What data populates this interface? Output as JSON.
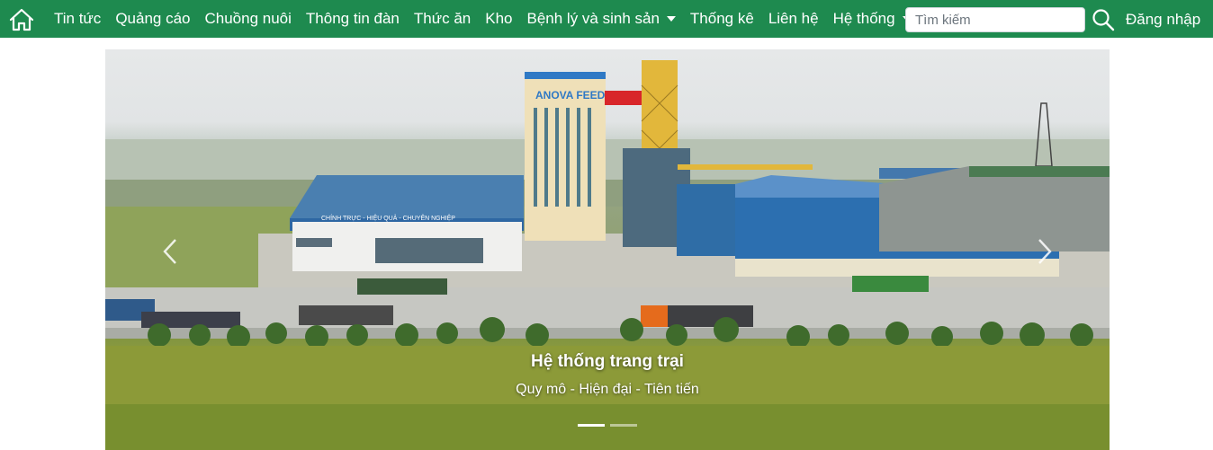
{
  "nav": {
    "menu": [
      {
        "label": "Tin tức",
        "dropdown": false
      },
      {
        "label": "Quảng cáo",
        "dropdown": false
      },
      {
        "label": "Chuồng nuôi",
        "dropdown": false
      },
      {
        "label": "Thông tin đàn",
        "dropdown": false
      },
      {
        "label": "Thức ăn",
        "dropdown": false
      },
      {
        "label": "Kho",
        "dropdown": false
      },
      {
        "label": "Bệnh lý và sinh sản",
        "dropdown": true
      },
      {
        "label": "Thống kê",
        "dropdown": false
      },
      {
        "label": "Liên hệ",
        "dropdown": false
      },
      {
        "label": "Hệ thống",
        "dropdown": true
      }
    ],
    "search_placeholder": "Tìm kiếm",
    "login_label": "Đăng nhập",
    "home_icon": "home-icon",
    "search_icon": "search-icon"
  },
  "carousel": {
    "slide": {
      "title": "Hệ thống trang trại",
      "subtitle": "Quy mô - Hiện đại - Tiên tiến",
      "building_sign_1": "ANOVA FEED",
      "building_sign_2": "CHÍNH TRỰC - HIỆU QUẢ - CHUYÊN NGHIỆP"
    },
    "indicator_count": 2,
    "active_indicator": 0
  },
  "colors": {
    "navbar": "#1e8a4f",
    "text_on_nav": "#ffffff"
  }
}
